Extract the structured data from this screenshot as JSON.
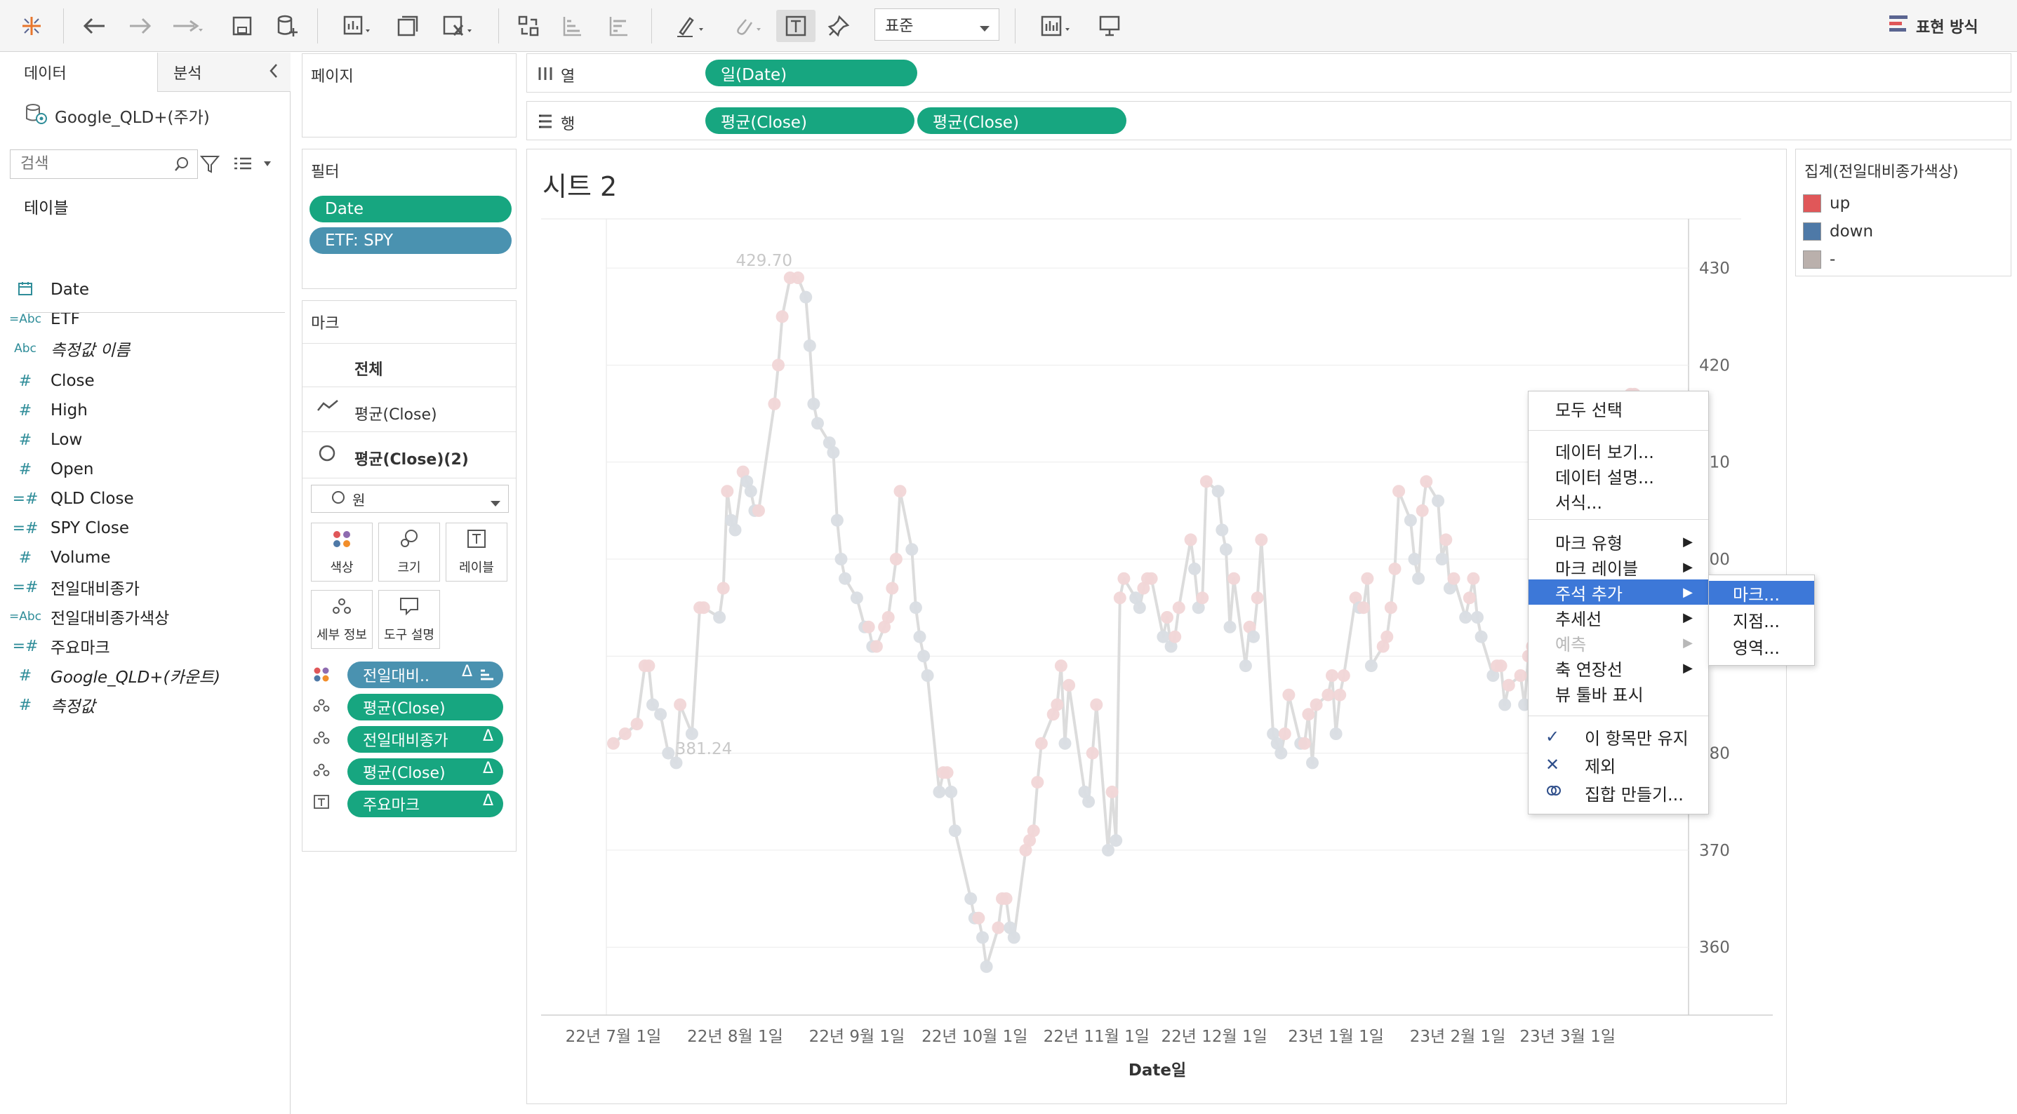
{
  "toolbar": {
    "style_select": "표준",
    "show_me": "표현 방식"
  },
  "left_panel": {
    "tab_data": "데이터",
    "tab_analysis": "분석",
    "datasource": "Google_QLD+(주가)",
    "search_placeholder": "검색",
    "tables_heading": "테이블",
    "fields": [
      {
        "icon": "calendar-icon",
        "label": "Date"
      },
      {
        "icon": "abc-calc",
        "label": "ETF"
      },
      {
        "icon": "abc",
        "label": "측정값 이름"
      },
      {
        "icon": "hash",
        "label": "Close"
      },
      {
        "icon": "hash",
        "label": "High"
      },
      {
        "icon": "hash",
        "label": "Low"
      },
      {
        "icon": "hash",
        "label": "Open"
      },
      {
        "icon": "hash-calc",
        "label": "QLD Close"
      },
      {
        "icon": "hash-calc",
        "label": "SPY Close"
      },
      {
        "icon": "hash",
        "label": "Volume"
      },
      {
        "icon": "hash-calc",
        "label": "전일대비종가"
      },
      {
        "icon": "abc-calc",
        "label": "전일대비종가색상"
      },
      {
        "icon": "hash-calc",
        "label": "주요마크"
      },
      {
        "icon": "hash",
        "label": "Google_QLD+(카운트)"
      },
      {
        "icon": "hash",
        "label": "측정값"
      }
    ]
  },
  "shelves": {
    "pages_title": "페이지",
    "filters_title": "필터",
    "filters": [
      "Date",
      "ETF: SPY"
    ],
    "columns_label": "열",
    "rows_label": "행",
    "columns": [
      "일(Date)"
    ],
    "rows": [
      "평균(Close)",
      "평균(Close)"
    ]
  },
  "marks": {
    "title": "마크",
    "all": "전체",
    "layer1": "평균(Close)",
    "layer2": "평균(Close)(2)",
    "mark_type": "원",
    "buttons": [
      "색상",
      "크기",
      "레이블",
      "세부 정보",
      "도구 설명"
    ],
    "pills": [
      "전일대비..",
      "평균(Close)",
      "전일대비종가",
      "평균(Close)",
      "주요마크"
    ]
  },
  "sheet": {
    "title": "시트 2",
    "xlabel": "Date일",
    "label_max": "429.70",
    "label_min": "381.24"
  },
  "legend": {
    "title": "집계(전일대비종가색상)",
    "items": [
      {
        "label": "up",
        "color": "#e05759"
      },
      {
        "label": "down",
        "color": "#4e79a7"
      },
      {
        "label": "-",
        "color": "#bab0ac"
      }
    ]
  },
  "context_menu": {
    "items": [
      {
        "label": "모두 선택"
      },
      {
        "label": "데이터 보기..."
      },
      {
        "label": "데이터 설명..."
      },
      {
        "label": "서식..."
      },
      {
        "label": "마크 유형"
      },
      {
        "label": "마크 레이블"
      },
      {
        "label": "주석 추가"
      },
      {
        "label": "추세선"
      },
      {
        "label": "예측"
      },
      {
        "label": "축 연장선"
      },
      {
        "label": "뷰 툴바 표시"
      },
      {
        "label": "이 항목만 유지"
      },
      {
        "label": "제외"
      },
      {
        "label": "집합 만들기..."
      }
    ],
    "submenu": [
      "마크...",
      "지점...",
      "영역..."
    ]
  },
  "chart_data": {
    "type": "line",
    "title": "",
    "xlabel": "Date일",
    "ylabel": "",
    "x_ticks": [
      "22년 7월 1일",
      "22년 8월 1일",
      "22년 9월 1일",
      "22년 10월 1일",
      "22년 11월 1일",
      "22년 12월 1일",
      "23년 1월 1일",
      "23년 2월 1일",
      "23년 3월 1일"
    ],
    "y_ticks": [
      360,
      370,
      380,
      390,
      400,
      410,
      420,
      430
    ],
    "ylim": [
      353,
      435
    ],
    "xlim": [
      0,
      272
    ],
    "series": [
      {
        "x": [
          0,
          3,
          6,
          8,
          9,
          10,
          12,
          14,
          16,
          17,
          20,
          22,
          23,
          27,
          28,
          29,
          30,
          31,
          33,
          34,
          35,
          36,
          37,
          41,
          42,
          43,
          45,
          47,
          49,
          50,
          51,
          52,
          55,
          56,
          57,
          58,
          59,
          62,
          64,
          65,
          66,
          67,
          69,
          70,
          71,
          72,
          73,
          76,
          77,
          78,
          79,
          80,
          83,
          84,
          85,
          86,
          87,
          91,
          92,
          93,
          94,
          95,
          98,
          99,
          100,
          101,
          102,
          105,
          106,
          107,
          108,
          109,
          112,
          113,
          114,
          115,
          116,
          120,
          121,
          122,
          123,
          126,
          127,
          128,
          129,
          130,
          133,
          134,
          135,
          136,
          137,
          140,
          141,
          142,
          143,
          144,
          147,
          148,
          149,
          150,
          151,
          154,
          155,
          156,
          157,
          158,
          161,
          162,
          163,
          164,
          165,
          168,
          169,
          170,
          171,
          172,
          175,
          176,
          177,
          178,
          179,
          182,
          183,
          184,
          185,
          186,
          189,
          190,
          191,
          192,
          193,
          196,
          197,
          198,
          199,
          200,
          203,
          204,
          205,
          206,
          207,
          210,
          211,
          212,
          213,
          214,
          217,
          218,
          219,
          220,
          221,
          224,
          225,
          226,
          227,
          228,
          231,
          232,
          233,
          234,
          235,
          238,
          239,
          240,
          241,
          242,
          245,
          246,
          247,
          248,
          249,
          252,
          253,
          254,
          255,
          256,
          259,
          260,
          261,
          262,
          263,
          266,
          267
        ],
        "values": [
          381,
          382,
          383,
          389,
          389,
          385,
          384,
          380,
          379,
          385,
          382,
          395,
          395,
          394,
          397,
          407,
          404,
          403,
          409,
          408,
          407,
          405,
          405,
          416,
          420,
          425,
          429,
          429,
          427,
          422,
          416,
          414,
          412,
          411,
          404,
          400,
          398,
          396,
          393,
          393,
          391,
          391,
          393,
          394,
          397,
          400,
          407,
          401,
          395,
          392,
          390,
          388,
          376,
          378,
          378,
          376,
          372,
          365,
          363,
          363,
          361,
          358,
          362,
          365,
          365,
          362,
          361,
          370,
          371,
          372,
          377,
          381,
          384,
          385,
          389,
          381,
          387,
          376,
          375,
          380,
          385,
          370,
          376,
          371,
          396,
          398,
          396,
          395,
          397,
          398,
          398,
          392,
          394,
          391,
          392,
          395,
          402,
          399,
          395,
          396,
          408,
          407,
          403,
          401,
          393,
          398,
          389,
          393,
          392,
          396,
          402,
          382,
          381,
          380,
          382,
          386,
          381,
          381,
          384,
          379,
          385,
          386,
          388,
          382,
          386,
          388,
          396,
          395,
          395,
          398,
          389,
          391,
          392,
          395,
          399,
          407,
          404,
          400,
          398,
          405,
          408,
          406,
          400,
          402,
          397,
          398,
          394,
          396,
          398,
          394,
          392,
          388,
          389,
          389,
          385,
          387,
          388,
          385,
          390,
          391,
          393,
          395,
          396,
          399,
          403,
          404,
          406,
          405,
          403,
          404,
          406,
          409,
          410,
          412,
          414,
          415,
          417,
          417,
          416,
          416,
          416,
          415,
          416
        ]
      }
    ]
  }
}
